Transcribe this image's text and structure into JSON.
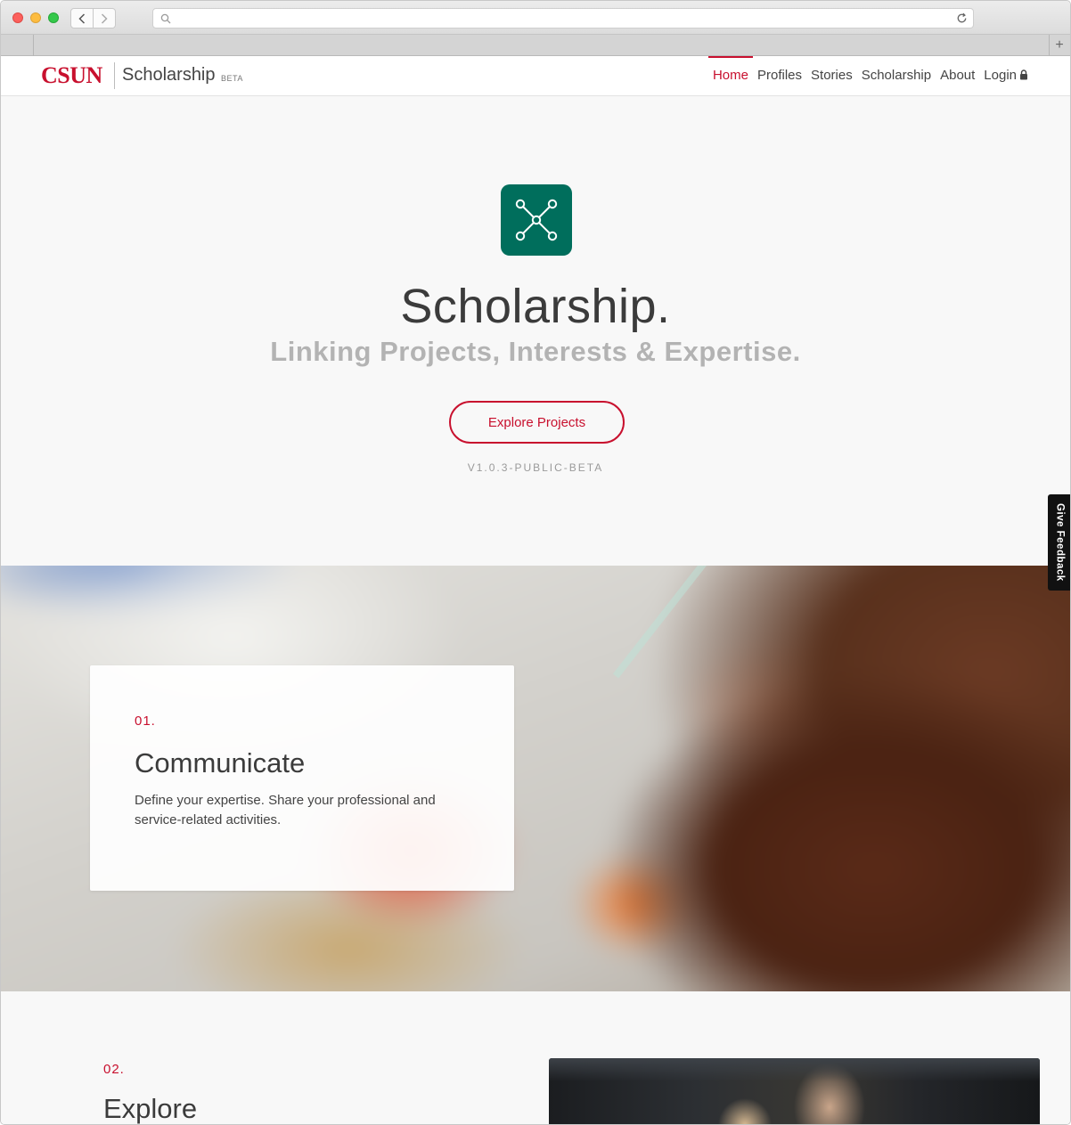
{
  "browser": {
    "address_value": "",
    "new_tab_symbol": "+"
  },
  "site": {
    "logo": "CSUN",
    "title": "Scholarship",
    "badge": "BETA"
  },
  "nav": {
    "items": [
      {
        "label": "Home",
        "active": true
      },
      {
        "label": "Profiles",
        "active": false
      },
      {
        "label": "Stories",
        "active": false
      },
      {
        "label": "Scholarship",
        "active": false
      },
      {
        "label": "About",
        "active": false
      },
      {
        "label": "Login",
        "active": false,
        "icon": "lock-icon"
      }
    ]
  },
  "hero": {
    "icon": "network-nodes-icon",
    "title": "Scholarship.",
    "subtitle": "Linking Projects, Interests & Expertise.",
    "cta_label": "Explore Projects",
    "version": "V1.0.3-PUBLIC-BETA"
  },
  "feedback": {
    "label": "Give Feedback"
  },
  "steps": [
    {
      "number": "01.",
      "title": "Communicate",
      "text": "Define your expertise. Share your professional and service-related activities."
    },
    {
      "number": "02.",
      "title": "Explore"
    }
  ],
  "colors": {
    "accent": "#c8102e",
    "icon_bg": "#006e5c",
    "page_bg": "#f8f8f8",
    "text": "#3b3b3b",
    "muted": "#b3b3b3"
  }
}
